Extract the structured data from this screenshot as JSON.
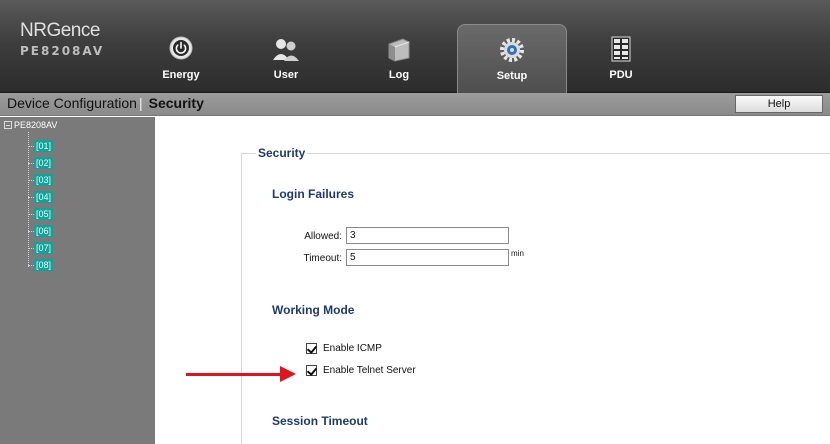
{
  "brand": {
    "logo": "NRGence",
    "model": "PE8208AV"
  },
  "nav": [
    {
      "id": "energy",
      "label": "Energy",
      "icon": "power-icon"
    },
    {
      "id": "user",
      "label": "User",
      "icon": "users-icon"
    },
    {
      "id": "log",
      "label": "Log",
      "icon": "log-icon"
    },
    {
      "id": "setup",
      "label": "Setup",
      "icon": "gear-icon",
      "active": true
    },
    {
      "id": "pdu",
      "label": "PDU",
      "icon": "pdu-icon"
    }
  ],
  "breadcrumb": {
    "parent": "Device Configuration",
    "separator": "|",
    "current": "Security"
  },
  "help_label": "Help",
  "tree": {
    "root": "PE8208AV",
    "nodes": [
      "[01]",
      "[02]",
      "[03]",
      "[04]",
      "[05]",
      "[06]",
      "[07]",
      "[08]"
    ]
  },
  "security": {
    "legend": "Security",
    "login_failures": {
      "title": "Login Failures",
      "allowed_label": "Allowed:",
      "allowed_value": "3",
      "timeout_label": "Timeout:",
      "timeout_value": "5",
      "timeout_unit": "min"
    },
    "working_mode": {
      "title": "Working Mode",
      "enable_icmp": {
        "label": "Enable ICMP",
        "checked": true
      },
      "enable_telnet": {
        "label": "Enable Telnet Server",
        "checked": true
      }
    },
    "session_timeout": {
      "title": "Session Timeout"
    }
  },
  "colors": {
    "header": "#3e3e3e",
    "subbar": "#8a8a8a",
    "sidebar": "#7a7a7a",
    "tree_tag": "#0fa39a",
    "section_title": "#1e3a6e",
    "annotation_arrow": "#e0141e"
  }
}
